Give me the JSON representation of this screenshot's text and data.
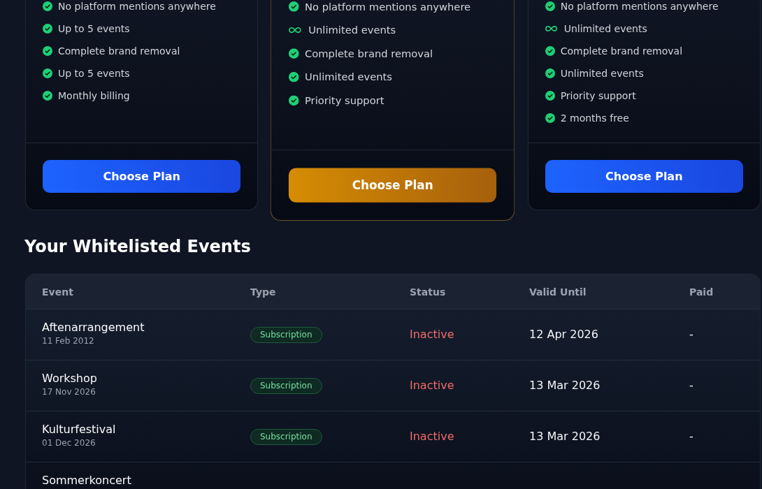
{
  "plans": [
    {
      "featured": false,
      "features": [
        {
          "kind": "check",
          "text": "No platform mentions anywhere"
        },
        {
          "kind": "check",
          "text": "Up to 5 events"
        },
        {
          "kind": "check",
          "text": "Complete brand removal"
        },
        {
          "kind": "check",
          "text": "Up to 5 events"
        },
        {
          "kind": "check",
          "text": "Monthly billing"
        }
      ],
      "button": "Choose Plan"
    },
    {
      "featured": true,
      "features": [
        {
          "kind": "check",
          "text": "No platform mentions anywhere"
        },
        {
          "kind": "infinity",
          "text": "Unlimited events"
        },
        {
          "kind": "check",
          "text": "Complete brand removal"
        },
        {
          "kind": "check",
          "text": "Unlimited events"
        },
        {
          "kind": "check",
          "text": "Priority support"
        }
      ],
      "button": "Choose Plan"
    },
    {
      "featured": false,
      "features": [
        {
          "kind": "check",
          "text": "No platform mentions anywhere"
        },
        {
          "kind": "infinity",
          "text": "Unlimited events"
        },
        {
          "kind": "check",
          "text": "Complete brand removal"
        },
        {
          "kind": "check",
          "text": "Unlimited events"
        },
        {
          "kind": "check",
          "text": "Priority support"
        },
        {
          "kind": "check",
          "text": "2 months free"
        }
      ],
      "button": "Choose Plan"
    }
  ],
  "events": {
    "title": "Your Whitelisted Events",
    "columns": [
      "Event",
      "Type",
      "Status",
      "Valid Until",
      "Paid"
    ],
    "rows": [
      {
        "name": "Aftenarrangement",
        "date": "11 Feb 2012",
        "type": "Subscription",
        "status": "Inactive",
        "active": false,
        "valid_until": "12 Apr 2026",
        "paid": "-"
      },
      {
        "name": "Workshop",
        "date": "17 Nov 2026",
        "type": "Subscription",
        "status": "Inactive",
        "active": false,
        "valid_until": "13 Mar 2026",
        "paid": "-"
      },
      {
        "name": "Kulturfestival",
        "date": "01 Dec 2026",
        "type": "Subscription",
        "status": "Inactive",
        "active": false,
        "valid_until": "13 Mar 2026",
        "paid": "-"
      },
      {
        "name": "Sommerkoncert"
      }
    ]
  }
}
